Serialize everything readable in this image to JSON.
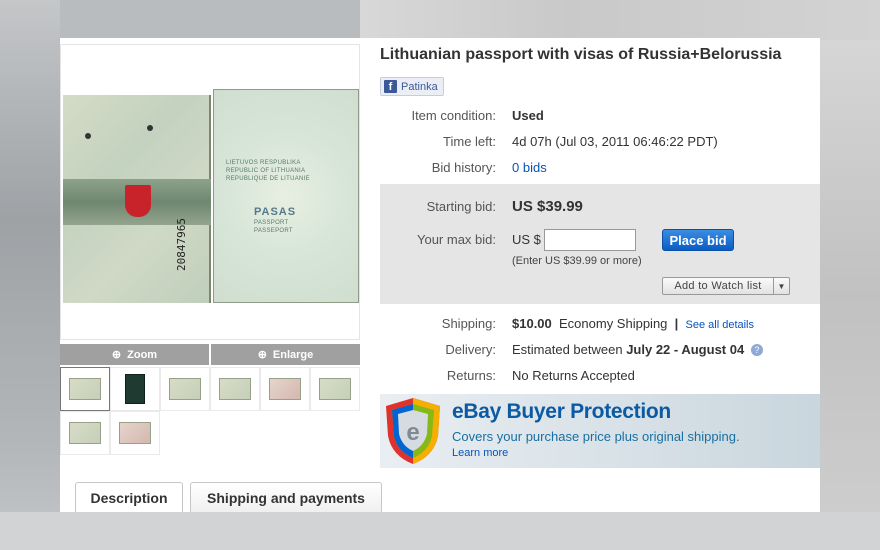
{
  "listing": {
    "title": "Lithuanian passport with visas of Russia+Belorussia",
    "like_label": "Patinka"
  },
  "image": {
    "zoom_label": "Zoom",
    "enlarge_label": "Enlarge",
    "passport_texts": {
      "line1": "LIETUVOS RESPUBLIKA",
      "line2": "REPUBLIC OF LITHUANIA",
      "line3": "REPUBLIQUE DE LITUANIE",
      "pasas": "PASAS",
      "passport1": "PASSPORT",
      "passport2": "PASSEPORT",
      "number": "20847965"
    },
    "thumbnail_count": 8
  },
  "details": {
    "condition": {
      "label": "Item condition:",
      "value": "Used"
    },
    "time_left": {
      "label": "Time left:",
      "value": "4d 07h (Jul 03, 2011 06:46:22 PDT)"
    },
    "bid_history": {
      "label": "Bid history:",
      "value": "0 bids"
    }
  },
  "bid": {
    "starting_label": "Starting bid:",
    "starting_value": "US $39.99",
    "max_label": "Your max bid:",
    "currency": "US $",
    "input_value": "",
    "place_bid": "Place bid",
    "note": "(Enter US $39.99 or more)",
    "watch_label": "Add to Watch list"
  },
  "shipping": {
    "label": "Shipping:",
    "price": "$10.00",
    "method": "Economy Shipping",
    "separator": "|",
    "details_link": "See all details"
  },
  "delivery": {
    "label": "Delivery:",
    "prefix": "Estimated between",
    "range": "July 22 - August 04",
    "help": "?"
  },
  "returns": {
    "label": "Returns:",
    "value": "No Returns Accepted"
  },
  "protection": {
    "title": "eBay Buyer Protection",
    "subtitle": "Covers your purchase price plus original shipping.",
    "link": "Learn more"
  },
  "tabs": {
    "description": "Description",
    "shipping": "Shipping and payments"
  },
  "colors": {
    "link": "#0654ba",
    "place_bid": "#0b5cc4",
    "protection_title": "#0b5aa3"
  }
}
